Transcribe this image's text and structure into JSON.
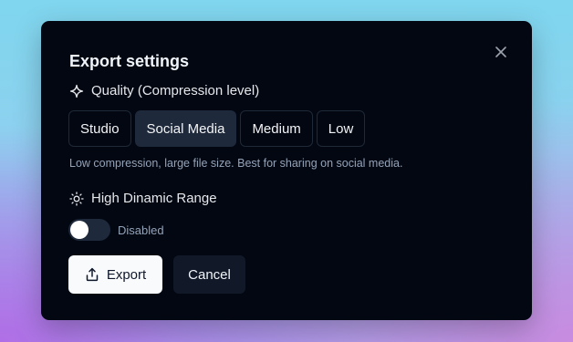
{
  "dialog": {
    "title": "Export settings",
    "close_icon": "close-icon"
  },
  "quality": {
    "label": "Quality (Compression level)",
    "icon": "sparkle-icon",
    "options": [
      "Studio",
      "Social Media",
      "Medium",
      "Low"
    ],
    "selected": "Social Media",
    "hint": "Low compression, large file size. Best for sharing on social media."
  },
  "hdr": {
    "label": "High Dinamic Range",
    "icon": "sun-icon",
    "enabled": false,
    "status": "Disabled"
  },
  "actions": {
    "export_label": "Export",
    "export_icon": "share-icon",
    "cancel_label": "Cancel"
  },
  "colors": {
    "dialog_bg": "#030712",
    "selected_option_bg": "#1e293b",
    "primary_button_bg": "#f8fafc",
    "secondary_button_bg": "#111827",
    "muted_text": "#94a3b8"
  }
}
